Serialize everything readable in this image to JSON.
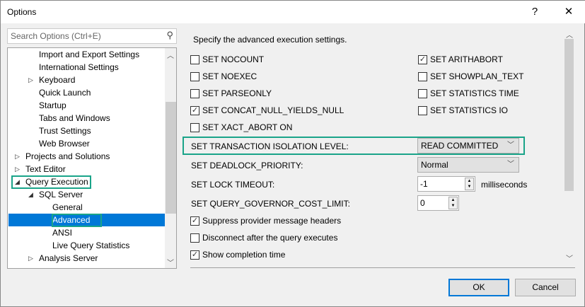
{
  "window": {
    "title": "Options",
    "help": "?",
    "close": "✕"
  },
  "search": {
    "placeholder": "Search Options (Ctrl+E)"
  },
  "tree": [
    {
      "label": "Import and Export Settings",
      "level": 2,
      "arrow": ""
    },
    {
      "label": "International Settings",
      "level": 2,
      "arrow": ""
    },
    {
      "label": "Keyboard",
      "level": 2,
      "arrow": "collapsed"
    },
    {
      "label": "Quick Launch",
      "level": 2,
      "arrow": ""
    },
    {
      "label": "Startup",
      "level": 2,
      "arrow": ""
    },
    {
      "label": "Tabs and Windows",
      "level": 2,
      "arrow": ""
    },
    {
      "label": "Trust Settings",
      "level": 2,
      "arrow": ""
    },
    {
      "label": "Web Browser",
      "level": 2,
      "arrow": ""
    },
    {
      "label": "Projects and Solutions",
      "level": 1,
      "arrow": "collapsed"
    },
    {
      "label": "Text Editor",
      "level": 1,
      "arrow": "collapsed"
    },
    {
      "label": "Query Execution",
      "level": 1,
      "arrow": "expanded"
    },
    {
      "label": "SQL Server",
      "level": 2,
      "arrow": "expanded"
    },
    {
      "label": "General",
      "level": 3,
      "arrow": ""
    },
    {
      "label": "Advanced",
      "level": 3,
      "arrow": "",
      "selected": true
    },
    {
      "label": "ANSI",
      "level": 3,
      "arrow": ""
    },
    {
      "label": "Live Query Statistics",
      "level": 3,
      "arrow": ""
    },
    {
      "label": "Analysis Server",
      "level": 2,
      "arrow": "collapsed"
    }
  ],
  "main": {
    "heading": "Specify the advanced execution settings.",
    "left_checks": [
      {
        "label": "SET NOCOUNT",
        "checked": false
      },
      {
        "label": "SET NOEXEC",
        "checked": false
      },
      {
        "label": "SET PARSEONLY",
        "checked": false
      },
      {
        "label": "SET CONCAT_NULL_YIELDS_NULL",
        "checked": true
      },
      {
        "label": "SET XACT_ABORT ON",
        "checked": false
      }
    ],
    "right_checks": [
      {
        "label": "SET ARITHABORT",
        "checked": true
      },
      {
        "label": "SET SHOWPLAN_TEXT",
        "checked": false
      },
      {
        "label": "SET STATISTICS TIME",
        "checked": false
      },
      {
        "label": "SET STATISTICS IO",
        "checked": false
      }
    ],
    "isolation_label": "SET TRANSACTION ISOLATION LEVEL:",
    "isolation_value": "READ COMMITTED",
    "deadlock_label": "SET DEADLOCK_PRIORITY:",
    "deadlock_value": "Normal",
    "lock_label": "SET LOCK TIMEOUT:",
    "lock_value": "-1",
    "lock_unit": "milliseconds",
    "governor_label": "SET QUERY_GOVERNOR_COST_LIMIT:",
    "governor_value": "0",
    "bottom_checks": [
      {
        "label": "Suppress provider message headers",
        "checked": true
      },
      {
        "label": "Disconnect after the query executes",
        "checked": false
      },
      {
        "label": "Show completion time",
        "checked": true
      }
    ]
  },
  "buttons": {
    "ok": "OK",
    "cancel": "Cancel"
  },
  "colors": {
    "highlight": "#1aa489",
    "selection": "#0078d7"
  }
}
